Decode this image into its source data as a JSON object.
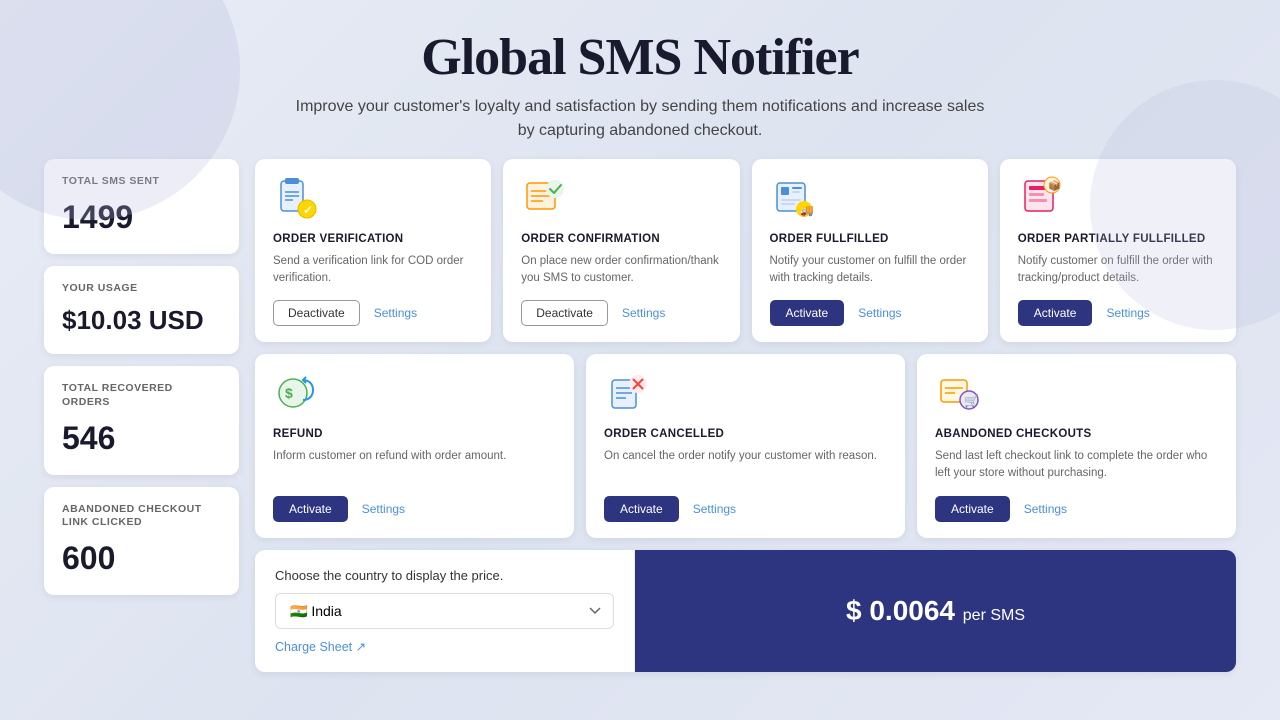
{
  "header": {
    "title": "Global SMS Notifier",
    "subtitle": "Improve your customer's loyalty and satisfaction by sending them notifications and increase sales by capturing abandoned checkout."
  },
  "sidebar": {
    "stats": [
      {
        "label": "TOTAL SMS SENT",
        "value": "1499",
        "id": "total-sms"
      },
      {
        "label": "YOUR USAGE",
        "value": "$10.03 USD",
        "id": "your-usage"
      },
      {
        "label": "TOTAL RECOVERED ORDERS",
        "value": "546",
        "id": "total-recovered"
      },
      {
        "label": "ABANDONED CHECKOUT LINK CLICKED",
        "value": "600",
        "id": "abandoned-clicks"
      }
    ]
  },
  "cards_row1": [
    {
      "id": "order-verification",
      "title": "ORDER VERIFICATION",
      "desc": "Send a verification link for COD order verification.",
      "status": "active",
      "button": "Deactivate",
      "buttonType": "deactivate"
    },
    {
      "id": "order-confirmation",
      "title": "ORDER CONFIRMATION",
      "desc": "On place new order confirmation/thank you SMS to customer.",
      "status": "active",
      "button": "Deactivate",
      "buttonType": "deactivate"
    },
    {
      "id": "order-fulfilled",
      "title": "ORDER FULLFILLED",
      "desc": "Notify your customer on fulfill the order with tracking details.",
      "status": "inactive",
      "button": "Activate",
      "buttonType": "activate"
    },
    {
      "id": "order-partially-fulfilled",
      "title": "ORDER PARTIALLY FULLFILLED",
      "desc": "Notify customer on fulfill the order with tracking/product details.",
      "status": "inactive",
      "button": "Activate",
      "buttonType": "activate"
    }
  ],
  "cards_row2": [
    {
      "id": "refund",
      "title": "REFUND",
      "desc": "Inform customer on refund with order amount.",
      "status": "inactive",
      "button": "Activate",
      "buttonType": "activate"
    },
    {
      "id": "order-cancelled",
      "title": "ORDER CANCELLED",
      "desc": "On cancel the order notify your customer with reason.",
      "status": "inactive",
      "button": "Activate",
      "buttonType": "activate"
    },
    {
      "id": "abandoned-checkouts",
      "title": "ABANDONED CHECKOUTS",
      "desc": "Send last left checkout link to complete the order who left your store without purchasing.",
      "status": "inactive",
      "button": "Activate",
      "buttonType": "activate"
    }
  ],
  "settings_label": "Settings",
  "bottom": {
    "country_label": "Choose the country to display the price.",
    "country_value": "India",
    "country_flag": "🇮🇳",
    "charge_sheet": "Charge Sheet",
    "price_dollar": "$",
    "price_value": "0.0064",
    "price_per": "per SMS"
  }
}
